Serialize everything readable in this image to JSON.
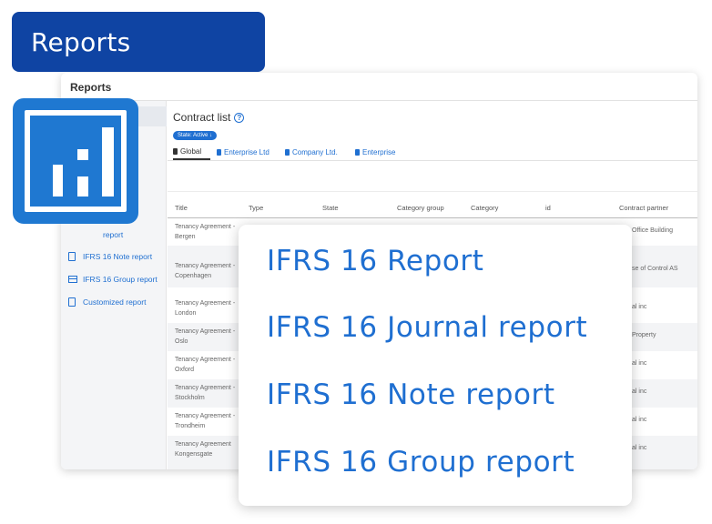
{
  "badge": {
    "label": "Reports"
  },
  "window": {
    "title": "Reports"
  },
  "sidebar": {
    "items": [
      {
        "label": "report",
        "icon": "document-icon"
      },
      {
        "label": "IFRS 16 Note report",
        "icon": "document-icon"
      },
      {
        "label": "IFRS 16 Group report",
        "icon": "table-icon"
      },
      {
        "label": "Customized report",
        "icon": "document-icon"
      }
    ]
  },
  "contract_list": {
    "title": "Contract list",
    "state_chip": "State: Active ↓",
    "tabs": [
      "Global",
      "Enterprise Ltd",
      "Company Ltd.",
      "Enterprise"
    ],
    "headers": [
      "Title",
      "Type",
      "State",
      "Category group",
      "Category",
      "id",
      "Contract partner"
    ],
    "rows": [
      {
        "title_line1": "Tenancy Agreement -",
        "title_line2": "Bergen",
        "partner": "Office Building"
      },
      {
        "title_line1": "Tenancy Agreement -",
        "title_line2": "Copenhagen",
        "partner": "se of Control AS"
      },
      {
        "title_line1": "Tenancy Agreement -",
        "title_line2": "London",
        "partner": "al inc"
      },
      {
        "title_line1": "Tenancy Agreement -",
        "title_line2": "Oslo",
        "partner": "Property"
      },
      {
        "title_line1": "Tenancy Agreement -",
        "title_line2": "Oxford",
        "partner": "al inc"
      },
      {
        "title_line1": "Tenancy Agreement -",
        "title_line2": "Stockholm",
        "partner": "al inc"
      },
      {
        "title_line1": "Tenancy Agreement -",
        "title_line2": "Trondheim",
        "partner": "al inc"
      },
      {
        "title_line1": "Tenancy Agreement",
        "title_line2": "Kongensgate",
        "partner": "al inc"
      }
    ]
  },
  "report_menu": {
    "items": [
      "IFRS 16 Report",
      "IFRS 16 Journal report",
      "IFRS 16 Note report",
      "IFRS 16 Group report"
    ]
  },
  "colors": {
    "badge": "#0f44a3",
    "accent": "#1f6fd1",
    "icon_card": "#1f78d1"
  }
}
